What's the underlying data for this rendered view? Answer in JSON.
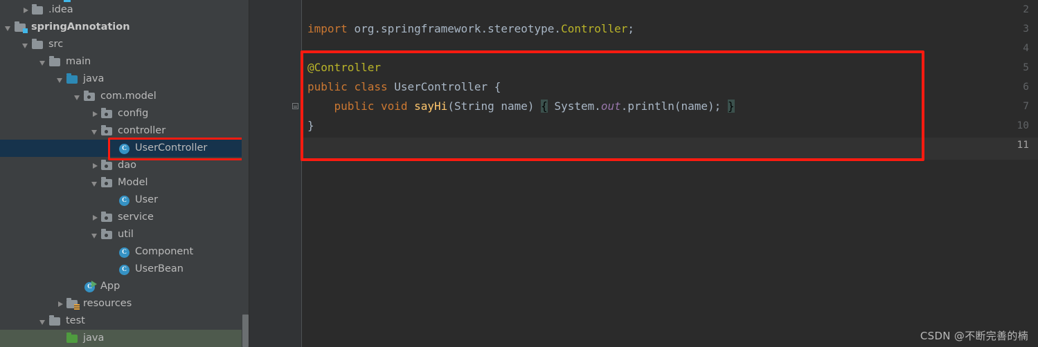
{
  "project_tree": {
    "name": "project-tool-window",
    "scrollbar": {
      "present": true
    },
    "items": [
      {
        "label": ".idea",
        "indent": 1,
        "toggle": "right",
        "icon": "folder-icon",
        "state": "normal"
      },
      {
        "label": "springAnnotation",
        "indent": 0,
        "toggle": "down",
        "icon": "module-folder-icon",
        "state": "bold"
      },
      {
        "label": "src",
        "indent": 1,
        "toggle": "down",
        "icon": "folder-icon",
        "state": "normal"
      },
      {
        "label": "main",
        "indent": 2,
        "toggle": "down",
        "icon": "folder-icon",
        "state": "normal"
      },
      {
        "label": "java",
        "indent": 3,
        "toggle": "down",
        "icon": "source-folder-icon",
        "state": "normal"
      },
      {
        "label": "com.model",
        "indent": 4,
        "toggle": "down",
        "icon": "package-folder-icon",
        "state": "normal"
      },
      {
        "label": "config",
        "indent": 5,
        "toggle": "right",
        "icon": "package-folder-icon",
        "state": "normal"
      },
      {
        "label": "controller",
        "indent": 5,
        "toggle": "down",
        "icon": "package-folder-icon",
        "state": "normal"
      },
      {
        "label": "UserController",
        "indent": 6,
        "toggle": "none",
        "icon": "java-class-icon",
        "state": "selected"
      },
      {
        "label": "dao",
        "indent": 5,
        "toggle": "right",
        "icon": "package-folder-icon",
        "state": "normal"
      },
      {
        "label": "Model",
        "indent": 5,
        "toggle": "down",
        "icon": "package-folder-icon",
        "state": "normal"
      },
      {
        "label": "User",
        "indent": 6,
        "toggle": "none",
        "icon": "java-class-icon",
        "state": "normal"
      },
      {
        "label": "service",
        "indent": 5,
        "toggle": "right",
        "icon": "package-folder-icon",
        "state": "normal"
      },
      {
        "label": "util",
        "indent": 5,
        "toggle": "down",
        "icon": "package-folder-icon",
        "state": "normal"
      },
      {
        "label": "Component",
        "indent": 6,
        "toggle": "none",
        "icon": "java-class-icon",
        "state": "normal"
      },
      {
        "label": "UserBean",
        "indent": 6,
        "toggle": "none",
        "icon": "java-class-icon",
        "state": "normal"
      },
      {
        "label": "App",
        "indent": 4,
        "toggle": "none",
        "icon": "java-runnable-class-icon",
        "state": "normal"
      },
      {
        "label": "resources",
        "indent": 3,
        "toggle": "right",
        "icon": "resources-folder-icon",
        "state": "normal"
      },
      {
        "label": "test",
        "indent": 2,
        "toggle": "down",
        "icon": "folder-icon",
        "state": "normal"
      },
      {
        "label": "java",
        "indent": 3,
        "toggle": "none",
        "icon": "green-folder-icon",
        "state": "hovered"
      }
    ]
  },
  "editor": {
    "name": "code-editor",
    "line_numbers": [
      "2",
      "3",
      "4",
      "5",
      "6",
      "7",
      "10",
      "11"
    ],
    "current_line_number": "11",
    "fold_marker_line": "7",
    "lines": [
      {
        "num": "2",
        "tokens": []
      },
      {
        "num": "3",
        "tokens": [
          {
            "t": "import ",
            "c": "kw"
          },
          {
            "t": "org.springframework.stereotype.",
            "c": "plain"
          },
          {
            "t": "Controller",
            "c": "ann"
          },
          {
            "t": ";",
            "c": "plain"
          }
        ]
      },
      {
        "num": "4",
        "tokens": []
      },
      {
        "num": "5",
        "tokens": [
          {
            "t": "@Controller",
            "c": "ann"
          }
        ]
      },
      {
        "num": "6",
        "tokens": [
          {
            "t": "public ",
            "c": "kw"
          },
          {
            "t": "class ",
            "c": "kw"
          },
          {
            "t": "UserController ",
            "c": "plain"
          },
          {
            "t": "{",
            "c": "plain"
          }
        ]
      },
      {
        "num": "7",
        "tokens": [
          {
            "t": "    ",
            "c": "plain"
          },
          {
            "t": "public ",
            "c": "kw"
          },
          {
            "t": "void ",
            "c": "kw"
          },
          {
            "t": "sayHi",
            "c": "mth"
          },
          {
            "t": "(String name) ",
            "c": "plain"
          },
          {
            "t": "{",
            "c": "braceHL"
          },
          {
            "t": " System.",
            "c": "plain"
          },
          {
            "t": "out",
            "c": "fld"
          },
          {
            "t": ".println(name); ",
            "c": "plain"
          },
          {
            "t": "}",
            "c": "braceHL"
          }
        ]
      },
      {
        "num": "10",
        "tokens": [
          {
            "t": "}",
            "c": "plain"
          }
        ]
      },
      {
        "num": "11",
        "tokens": []
      }
    ]
  },
  "annotations": {
    "tree_highlight_box": {
      "name": "red-highlight-box-usercontroller",
      "color": "#fc1b10"
    },
    "code_highlight_box": {
      "name": "red-highlight-box-class-body",
      "color": "#fc1b10"
    }
  },
  "watermark": {
    "text": "CSDN @不断完善的楠"
  }
}
